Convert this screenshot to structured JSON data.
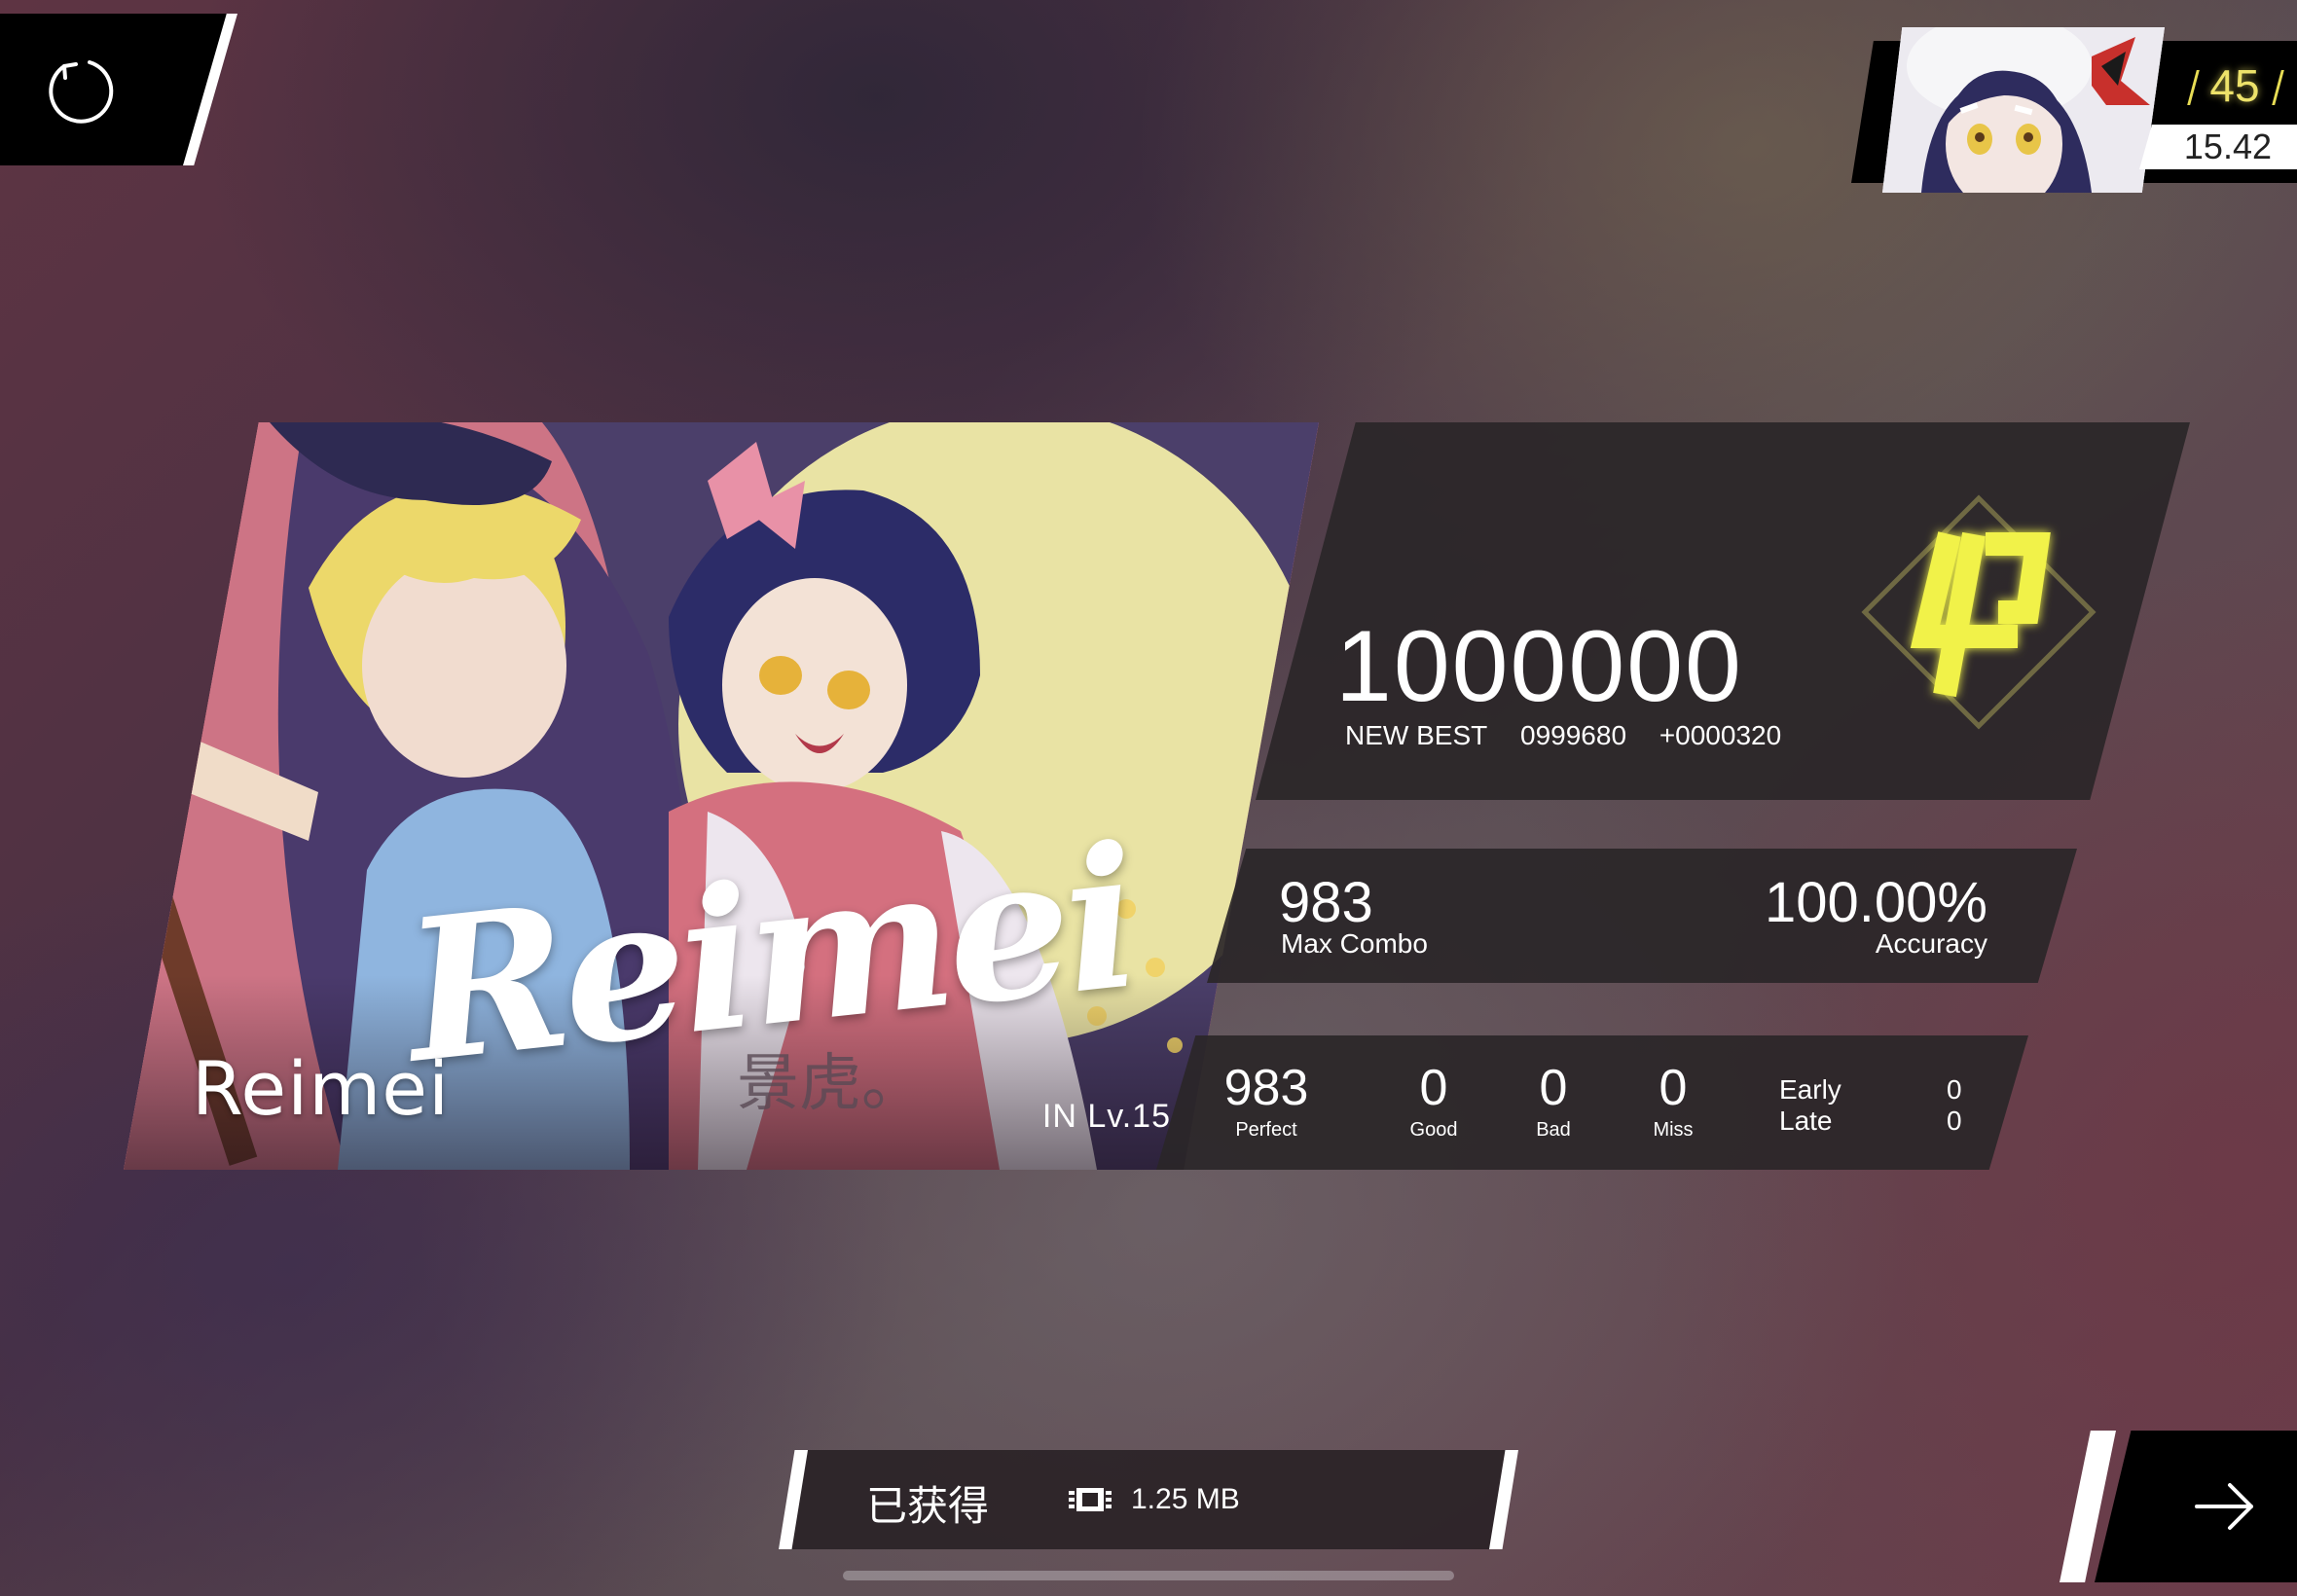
{
  "player": {
    "level": "45",
    "rks": "15.42"
  },
  "song": {
    "title": "Reimei",
    "logo_text": "Reimei",
    "artist_signature": "景虎。",
    "difficulty": "IN  Lv.15"
  },
  "result": {
    "score": "1000000",
    "new_best_label": "NEW BEST",
    "previous_best": "0999680",
    "score_delta": "+0000320",
    "grade": "φ",
    "max_combo": "983",
    "max_combo_label": "Max Combo",
    "accuracy": "100.00%",
    "accuracy_label": "Accuracy",
    "judgements": [
      {
        "label": "Perfect",
        "value": "983"
      },
      {
        "label": "Good",
        "value": "0"
      },
      {
        "label": "Bad",
        "value": "0"
      },
      {
        "label": "Miss",
        "value": "0"
      }
    ],
    "early_label": "Early",
    "late_label": "Late",
    "early_value": "0",
    "late_value": "0"
  },
  "reward": {
    "title": "已获得",
    "size": "1.25 MB",
    "icon": "chip-icon"
  },
  "colors": {
    "accent_yellow": "#eef04a",
    "panel": "#2a2628",
    "button": "#000000"
  },
  "icons": {
    "retry": "retry-icon",
    "next": "arrow-right-icon"
  }
}
